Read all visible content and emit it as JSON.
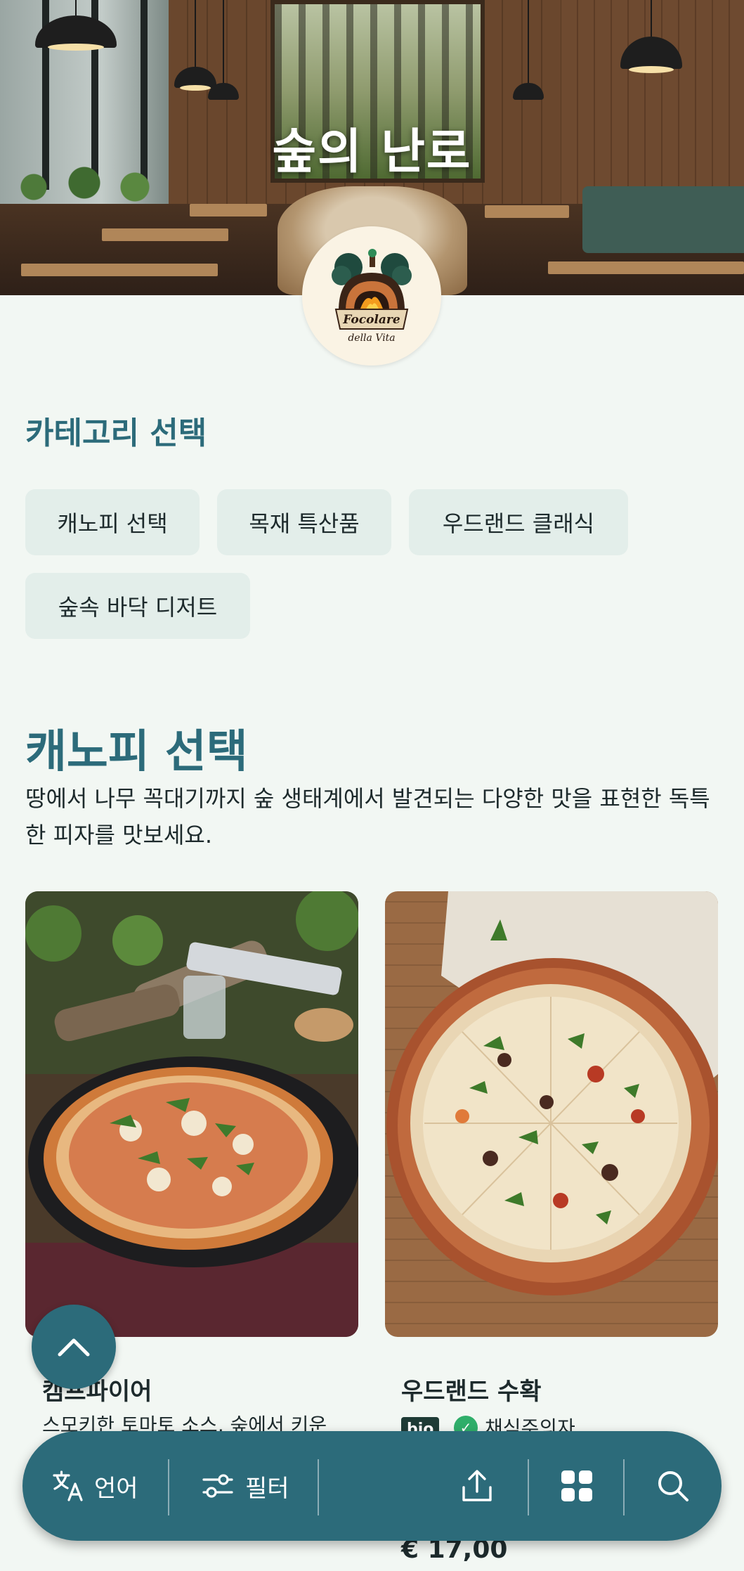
{
  "hero": {
    "title": "숲의 난로"
  },
  "logo": {
    "line1": "Focolare",
    "line2": "della Vita"
  },
  "categories": {
    "heading": "카테고리 선택",
    "chips": [
      {
        "label": "캐노피 선택"
      },
      {
        "label": "목재 특산품"
      },
      {
        "label": "우드랜드 클래식"
      },
      {
        "label": "숲속 바닥 디저트"
      }
    ]
  },
  "section": {
    "title": "캐노피 선택",
    "description": "땅에서 나무 꼭대기까지 숲 생태계에서 발견되는 다양한 맛을 표현한 독특한 피자를 맛보세요."
  },
  "products": [
    {
      "name": "캠프파이어",
      "description": "스모키한 토마토 소스, 숲에서 키운"
    },
    {
      "name": "우드랜드 수확",
      "badge_bio": "bio",
      "badge_veg": "채식주의자",
      "price": "€ 17,00"
    }
  ],
  "bottom_bar": {
    "language_label": "언어",
    "filter_label": "필터",
    "icons": [
      "translate-icon",
      "filter-icon",
      "share-icon",
      "grid-icon",
      "search-icon"
    ]
  },
  "colors": {
    "accent": "#2c6b7a",
    "background": "#f2f7f3",
    "chip": "#e3eeea"
  }
}
